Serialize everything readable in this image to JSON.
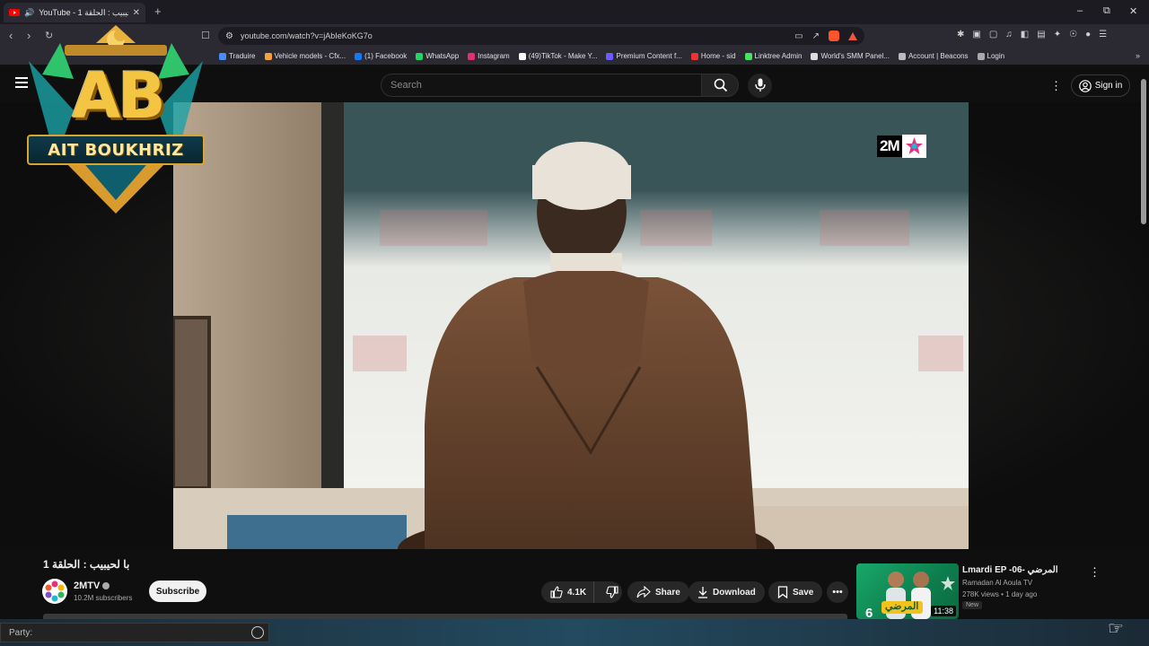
{
  "browser": {
    "tab": {
      "title": "YouTube - با لحيبيب : الحلقة 1",
      "icon": "youtube-icon",
      "audio_icon": "speaker-icon"
    },
    "new_tab_symbol": "+",
    "window_controls": [
      "–",
      "⧉",
      "✕"
    ],
    "url": "youtube.com/watch?v=jAbIeKoKG7o",
    "bookmarks": [
      {
        "label": "Traduire",
        "color": "#4a8cf7"
      },
      {
        "label": "Vehicle models - Cfx...",
        "color": "#f4a13b"
      },
      {
        "label": "(1) Facebook",
        "color": "#1877f2"
      },
      {
        "label": "WhatsApp",
        "color": "#25d366"
      },
      {
        "label": "Instagram",
        "color": "#e1306c"
      },
      {
        "label": "(49)TikTok - Make Y...",
        "color": "#ffffff"
      },
      {
        "label": "Premium Content f...",
        "color": "#6d5bff"
      },
      {
        "label": "Home - sid",
        "color": "#e33"
      },
      {
        "label": "Linktree Admin",
        "color": "#43e55e"
      },
      {
        "label": "World's SMM Panel...",
        "color": "#dddddd"
      },
      {
        "label": "Account | Beacons",
        "color": "#bbbbbb"
      },
      {
        "label": "Login",
        "color": "#aaaaaa"
      }
    ],
    "bookmarks_more": "»"
  },
  "youtube": {
    "search_placeholder": "Search",
    "signin_label": "Sign in"
  },
  "overlay_logo": {
    "initials": "AB",
    "name": "AIT BOUKHRIZ"
  },
  "tv_logo": "2M",
  "video": {
    "title": "با لحيبيب : الحلقة 1",
    "channel": "2MTV",
    "subscribers": "10.2M subscribers",
    "subscribe_label": "Subscribe",
    "likes": "4.1K",
    "share_label": "Share",
    "download_label": "Download",
    "save_label": "Save",
    "more_symbol": "•••"
  },
  "recommended": {
    "title": "Lmardi EP -06- المرضي",
    "channel": "Ramadan Al Aoula TV",
    "meta": "278K views • 1 day ago",
    "badge": "New",
    "duration": "11:38",
    "episode_number": "6",
    "thumb_text": "المرضي"
  },
  "bottom_bar": {
    "party_label": "Party:"
  },
  "colors": {
    "youtube_red": "#ff0000",
    "logo_gold": "#f4c542",
    "logo_teal": "#0f3a4a",
    "thumb_green": "#19a86a"
  }
}
